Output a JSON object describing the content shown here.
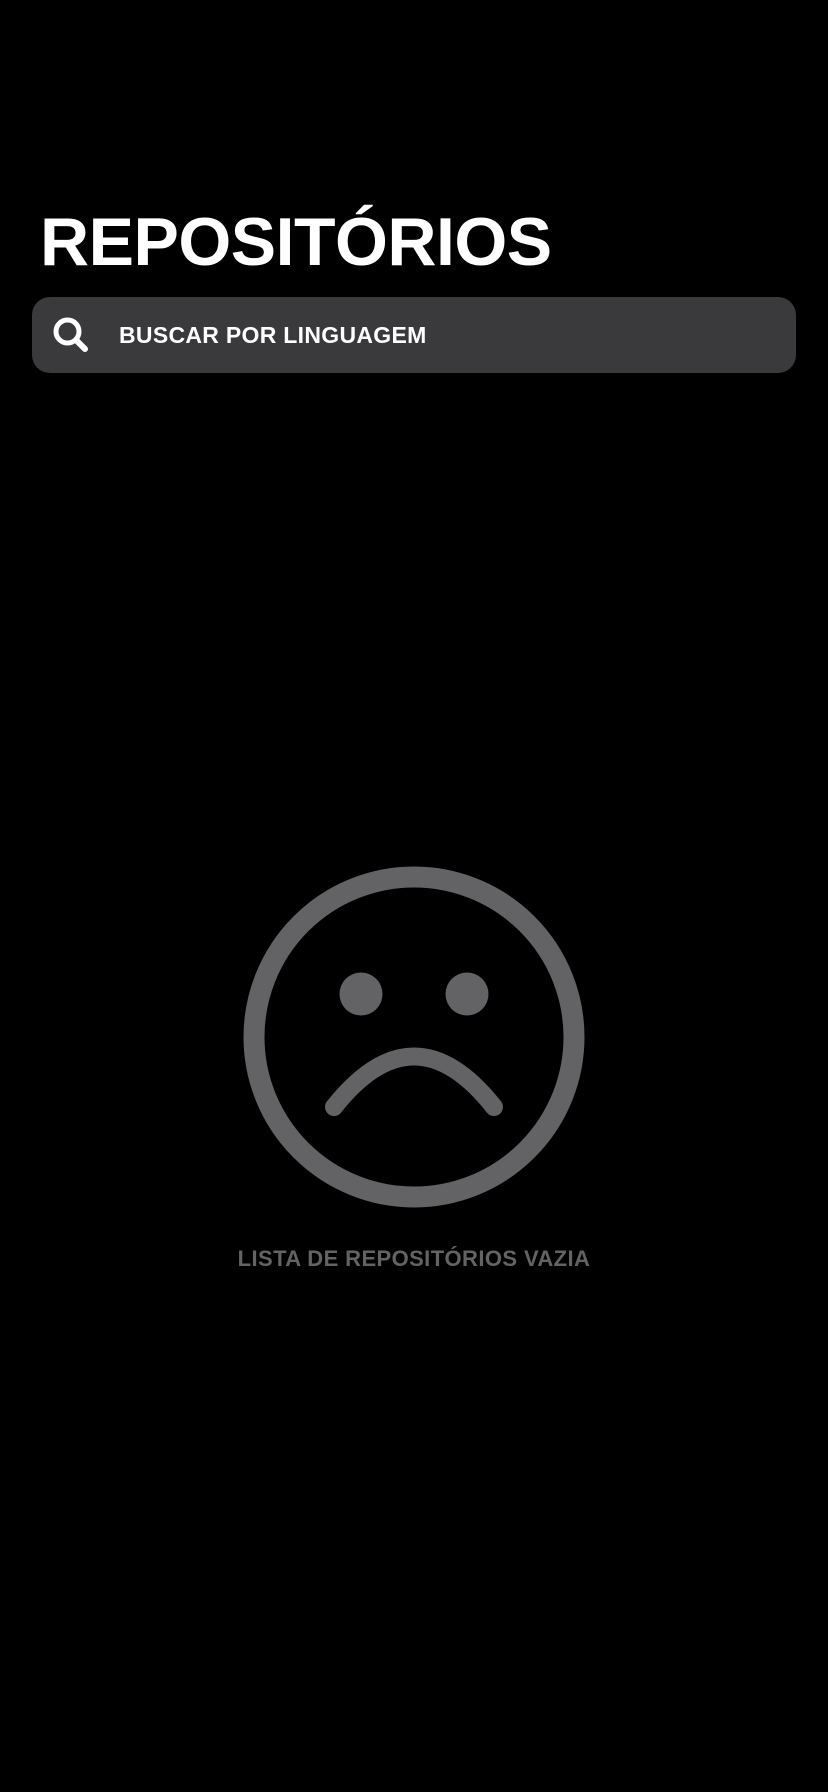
{
  "header": {
    "title": "REPOSITÓRIOS"
  },
  "search": {
    "icon": "search-icon",
    "placeholder": "BUSCAR POR LINGUAGEM",
    "value": ""
  },
  "empty_state": {
    "icon": "sad-face-icon",
    "message": "LISTA DE REPOSITÓRIOS VAZIA"
  },
  "colors": {
    "background": "#000000",
    "search_background": "#3a3a3c",
    "title_text": "#ffffff",
    "muted_gray": "#636366"
  }
}
